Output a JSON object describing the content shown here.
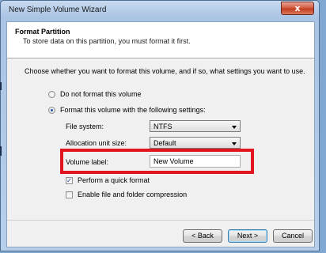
{
  "window": {
    "title": "New Simple Volume Wizard",
    "close_glyph": "x"
  },
  "header": {
    "heading": "Format Partition",
    "subheading": "To store data on this partition, you must format it first."
  },
  "instruction": "Choose whether you want to format this volume, and if so, what settings you want to use.",
  "options": {
    "do_not_format": {
      "label": "Do not format this volume",
      "selected": false
    },
    "format": {
      "label": "Format this volume with the following settings:",
      "selected": true
    }
  },
  "settings": {
    "file_system": {
      "label": "File system:",
      "value": "NTFS"
    },
    "allocation_unit": {
      "label": "Allocation unit size:",
      "value": "Default"
    },
    "volume_label": {
      "label": "Volume label:",
      "value": "New Volume"
    }
  },
  "checkboxes": {
    "quick_format": {
      "label": "Perform a quick format",
      "checked": true
    },
    "compression": {
      "label": "Enable file and folder compression",
      "checked": false
    }
  },
  "buttons": {
    "back": "< Back",
    "next": "Next >",
    "cancel": "Cancel"
  },
  "icons": {
    "close": "close-icon",
    "dropdown": "chevron-down-icon",
    "check": "checkmark-icon"
  },
  "colors": {
    "highlight": "#e0151f",
    "window_frame": "#a9c4e4",
    "dialog_background": "#f0f0f0"
  }
}
